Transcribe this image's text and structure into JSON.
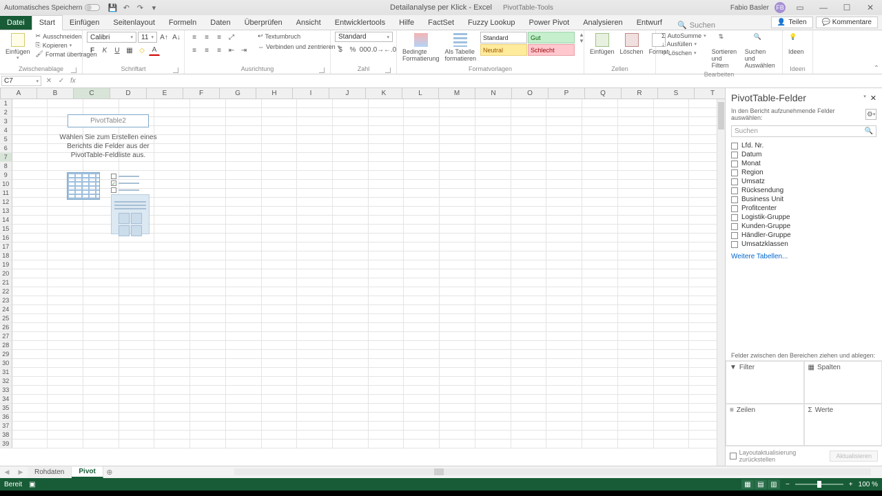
{
  "titlebar": {
    "autosave": "Automatisches Speichern",
    "doc_title": "Detailanalyse per Klick - Excel",
    "tools_title": "PivotTable-Tools",
    "user": "Fabio Basler",
    "user_initials": "FB"
  },
  "tabs": {
    "file": "Datei",
    "items": [
      "Start",
      "Einfügen",
      "Seitenlayout",
      "Formeln",
      "Daten",
      "Überprüfen",
      "Ansicht",
      "Entwicklertools",
      "Hilfe",
      "FactSet",
      "Fuzzy Lookup",
      "Power Pivot",
      "Analysieren",
      "Entwurf"
    ],
    "active": "Start",
    "tell_me": "Suchen",
    "share": "Teilen",
    "comments": "Kommentare"
  },
  "ribbon": {
    "clipboard": {
      "paste": "Einfügen",
      "cut": "Ausschneiden",
      "copy": "Kopieren",
      "format_painter": "Format übertragen",
      "label": "Zwischenablage"
    },
    "font": {
      "name": "Calibri",
      "size": "11",
      "label": "Schriftart"
    },
    "align": {
      "wrap": "Textumbruch",
      "merge": "Verbinden und zentrieren",
      "label": "Ausrichtung"
    },
    "number": {
      "format": "Standard",
      "label": "Zahl"
    },
    "styles": {
      "cond": "Bedingte Formatierung",
      "table": "Als Tabelle formatieren",
      "standard": "Standard",
      "gut": "Gut",
      "neutral": "Neutral",
      "schlecht": "Schlecht",
      "label": "Formatvorlagen"
    },
    "cells": {
      "insert": "Einfügen",
      "delete": "Löschen",
      "format": "Format",
      "label": "Zellen"
    },
    "editing": {
      "sum": "AutoSumme",
      "fill": "Ausfüllen",
      "clear": "Löschen",
      "sort": "Sortieren und Filtern",
      "find": "Suchen und Auswählen",
      "label": "Bearbeiten"
    },
    "ideas": {
      "btn": "Ideen",
      "label": "Ideen"
    }
  },
  "formula_bar": {
    "name_box": "C7"
  },
  "grid": {
    "columns": [
      "A",
      "B",
      "C",
      "D",
      "E",
      "F",
      "G",
      "H",
      "I",
      "J",
      "K",
      "L",
      "M",
      "N",
      "O",
      "P",
      "Q",
      "R",
      "S",
      "T"
    ],
    "row_count": 39,
    "pivot_title": "PivotTable2",
    "pivot_hint_1": "Wählen Sie zum Erstellen eines",
    "pivot_hint_2": "Berichts die Felder aus der",
    "pivot_hint_3": "PivotTable-Feldliste aus."
  },
  "pane": {
    "title": "PivotTable-Felder",
    "subtitle": "In den Bericht aufzunehmende Felder auswählen:",
    "search_ph": "Suchen",
    "fields": [
      "Lfd. Nr.",
      "Datum",
      "Monat",
      "Region",
      "Umsatz",
      "Rücksendung",
      "Business Unit",
      "Profitcenter",
      "Logistik-Gruppe",
      "Kunden-Gruppe",
      "Händler-Gruppe",
      "Umsatzklassen"
    ],
    "more_tables": "Weitere Tabellen...",
    "areas_hint": "Felder zwischen den Bereichen ziehen und ablegen:",
    "filter": "Filter",
    "columns": "Spalten",
    "rows": "Zeilen",
    "values": "Werte",
    "defer": "Layoutaktualisierung zurückstellen",
    "update": "Aktualisieren"
  },
  "sheets": {
    "items": [
      "Rohdaten",
      "Pivot"
    ],
    "active": "Pivot"
  },
  "status": {
    "ready": "Bereit",
    "zoom": "100 %"
  }
}
